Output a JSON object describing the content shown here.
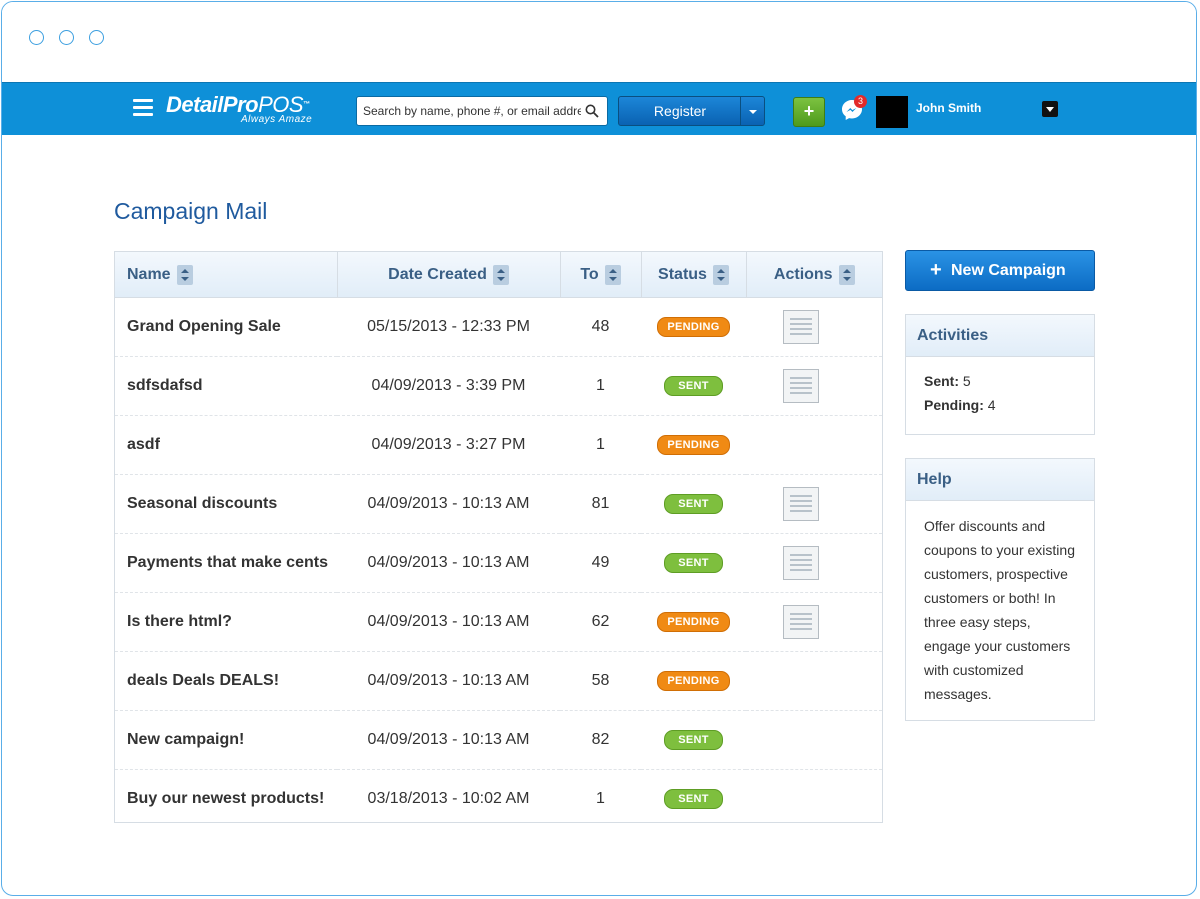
{
  "header": {
    "logo_brand": "DetailPro",
    "logo_pos": "POS",
    "logo_tm": "™",
    "logo_tagline": "Always Amaze",
    "search_placeholder": "Search by name, phone #, or email address",
    "register_label": "Register",
    "add_label": "+",
    "message_count": "3",
    "user_name": "John Smith"
  },
  "page": {
    "title": "Campaign Mail"
  },
  "table": {
    "columns": [
      "Name",
      "Date Created",
      "To",
      "Status",
      "Actions"
    ],
    "rows": [
      {
        "name": "Grand Opening Sale",
        "date": "05/15/2013 - 12:33 PM",
        "to": "48",
        "status": "PENDING",
        "status_type": "pending",
        "has_action": true
      },
      {
        "name": "sdfsdafsd",
        "date": "04/09/2013 - 3:39 PM",
        "to": "1",
        "status": "SENT",
        "status_type": "sent",
        "has_action": true
      },
      {
        "name": "asdf",
        "date": "04/09/2013 - 3:27 PM",
        "to": "1",
        "status": "PENDING",
        "status_type": "pending",
        "has_action": false
      },
      {
        "name": "Seasonal discounts",
        "date": "04/09/2013 - 10:13 AM",
        "to": "81",
        "status": "SENT",
        "status_type": "sent",
        "has_action": true
      },
      {
        "name": "Payments that make cents",
        "date": "04/09/2013 - 10:13 AM",
        "to": "49",
        "status": "SENT",
        "status_type": "sent",
        "has_action": true
      },
      {
        "name": "Is there html?",
        "date": "04/09/2013 - 10:13 AM",
        "to": "62",
        "status": "PENDING",
        "status_type": "pending",
        "has_action": true
      },
      {
        "name": "deals Deals DEALS!",
        "date": "04/09/2013 - 10:13 AM",
        "to": "58",
        "status": "PENDING",
        "status_type": "pending",
        "has_action": false
      },
      {
        "name": "New campaign!",
        "date": "04/09/2013 - 10:13 AM",
        "to": "82",
        "status": "SENT",
        "status_type": "sent",
        "has_action": false
      },
      {
        "name": "Buy our newest products!",
        "date": "03/18/2013 - 10:02 AM",
        "to": "1",
        "status": "SENT",
        "status_type": "sent",
        "has_action": false
      }
    ]
  },
  "sidebar": {
    "new_campaign_plus": "+",
    "new_campaign_label": "New Campaign",
    "activities": {
      "title": "Activities",
      "sent_label": "Sent:",
      "sent_value": "5",
      "pending_label": "Pending:",
      "pending_value": "4"
    },
    "help": {
      "title": "Help",
      "text": "Offer discounts and coupons to your existing customers, prospective customers or both! In three easy steps, engage your customers with customized messages."
    }
  },
  "colors": {
    "navbar": "#0e90d8",
    "pending": "#f08a14",
    "sent": "#7ebf3e",
    "title": "#1f5a9e"
  }
}
